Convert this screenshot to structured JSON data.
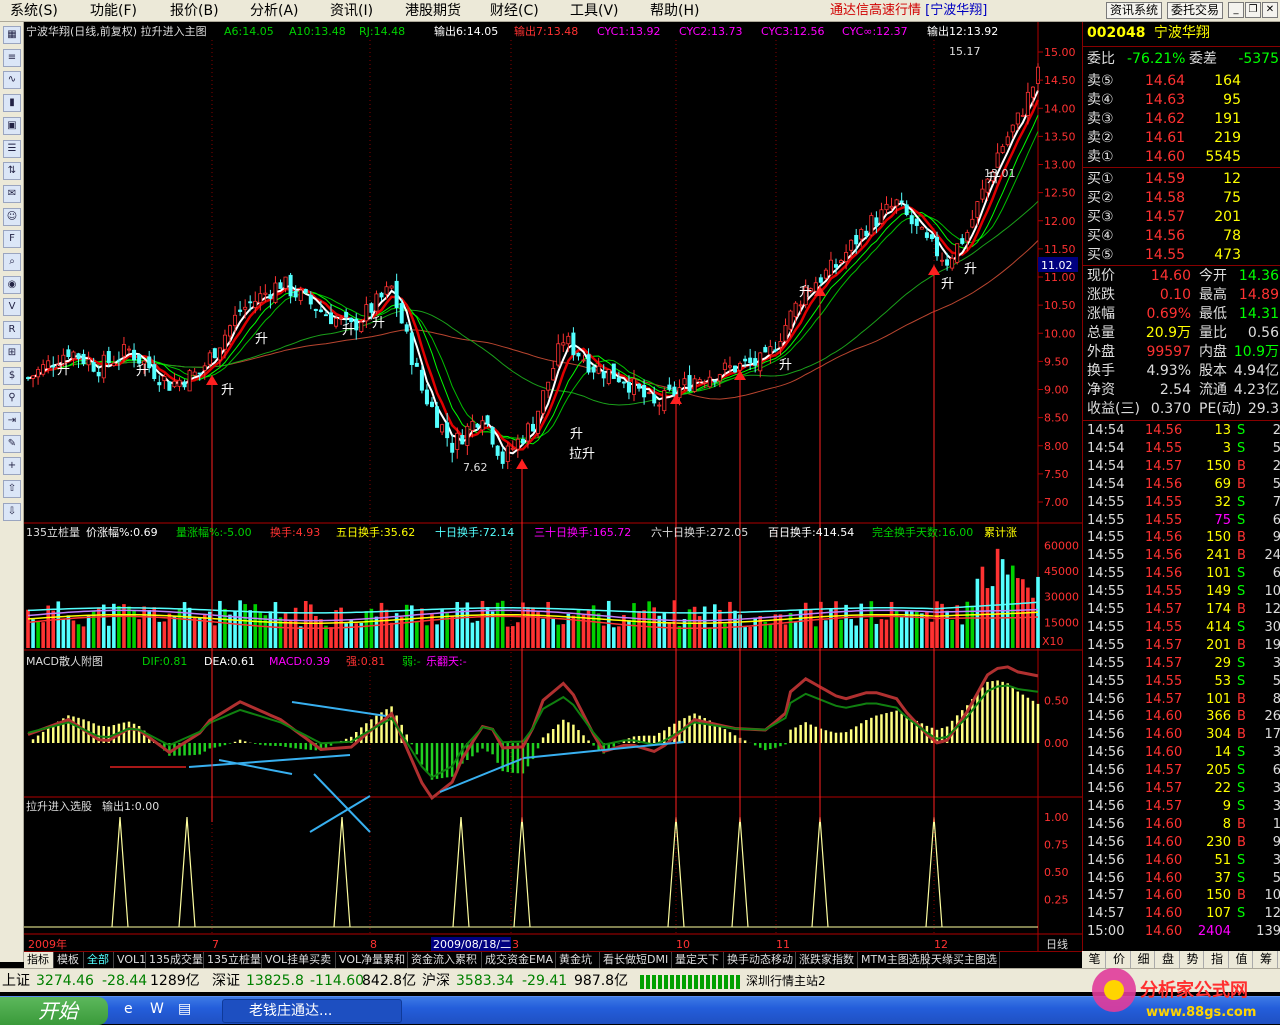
{
  "menu": {
    "items": [
      "系统(S)",
      "功能(F)",
      "报价(B)",
      "分析(A)",
      "资讯(I)",
      "港股期货",
      "财经(C)",
      "工具(V)",
      "帮助(H)"
    ],
    "title": "通达信高速行情",
    "stock_tag": "[宁波华翔]",
    "btn_news": "资讯系统",
    "btn_trade": "委托交易"
  },
  "toolbar_icons": [
    "grid-icon",
    "list-icon",
    "line-chart-icon",
    "kline-icon",
    "window-icon",
    "table-icon",
    "sort-icon",
    "mail-icon",
    "users-icon",
    "f10-icon",
    "search-icon",
    "eye-icon",
    "vol-icon",
    "rsi-icon",
    "calc-icon",
    "dollar-icon",
    "link-icon",
    "exit-icon",
    "pen-icon",
    "plus-icon",
    "up-arrow-icon",
    "down-arrow-icon"
  ],
  "main_header": {
    "name": "宁波华翔(日线,前复权) 拉升进入主图",
    "a6": "A6:14.05",
    "a10": "A10:13.48",
    "rj": "RJ:14.48",
    "out6": "输出6:14.05",
    "out7": "输出7:13.48",
    "cyc1": "CYC1:13.92",
    "cyc2": "CYC2:13.73",
    "cyc3": "CYC3:12.56",
    "cycinf": "CYC∞:12.37",
    "out12": "输出12:13.92"
  },
  "price_axis": [
    "15.00",
    "14.50",
    "14.00",
    "13.50",
    "13.00",
    "12.50",
    "12.00",
    "11.50",
    "11.00",
    "10.50",
    "10.00",
    "9.50",
    "9.00",
    "8.50",
    "8.00",
    "7.50",
    "7.00"
  ],
  "price_marks": {
    "high": "15.17",
    "low": "7.62",
    "mid": "13.01",
    "current": "11.02"
  },
  "signal_label": "升",
  "signal_label2": "拉升",
  "vol_header": {
    "name": "135立桩量",
    "p1": "价涨幅%:0.69",
    "p2": "量涨幅%:-5.00",
    "p3": "换手:4.93",
    "p4": "五日换手:35.62",
    "p5": "十日换手:72.14",
    "p6": "三十日换手:165.72",
    "p7": "六十日换手:272.05",
    "p8": "百日换手:414.54",
    "p9": "完全换手天数:16.00",
    "p10": "累计涨"
  },
  "vol_axis": [
    "60000",
    "45000",
    "30000",
    "15000"
  ],
  "vol_unit": "X10",
  "macd_header": {
    "name": "MACD散人附图",
    "dif": "DIF:0.81",
    "dea": "DEA:0.61",
    "macd": "MACD:0.39",
    "strong": "强:0.81",
    "weak": "弱:-",
    "extra": "乐翻天:-"
  },
  "macd_axis": [
    "0.50",
    "0.00"
  ],
  "sel_header": {
    "name": "拉升进入选股",
    "out": "输出1:0.00"
  },
  "sel_axis": [
    "1.00",
    "0.75",
    "0.50",
    "0.25"
  ],
  "x_axis": {
    "year": "2009年",
    "m7": "7",
    "m8": "8",
    "cursor": "2009/08/18/二",
    "m9": "3",
    "m10": "10",
    "m11": "11",
    "m12": "12",
    "period": "日线"
  },
  "tabs": [
    "指标",
    "模板",
    "全部",
    "VOL1",
    "135成交量",
    "135立桩量",
    "VOL挂单买卖",
    "VOL净量累和",
    "资金流入累积",
    "成交资金EMA",
    "黄金坑",
    "看长做短DMI",
    "量定天下",
    "换手动态移动",
    "涨跌家指数",
    "MTM主图选股",
    "天缘买主图选"
  ],
  "right_panel": {
    "code": "002048",
    "name": "宁波华翔",
    "weibi_label": "委比",
    "weibi": "-76.21%",
    "weicha_label": "委差",
    "weicha": "-5375",
    "asks": [
      {
        "label": "卖⑤",
        "price": "14.64",
        "vol": "164"
      },
      {
        "label": "卖④",
        "price": "14.63",
        "vol": "95"
      },
      {
        "label": "卖③",
        "price": "14.62",
        "vol": "191"
      },
      {
        "label": "卖②",
        "price": "14.61",
        "vol": "219"
      },
      {
        "label": "卖①",
        "price": "14.60",
        "vol": "5545"
      }
    ],
    "bids": [
      {
        "label": "买①",
        "price": "14.59",
        "vol": "12"
      },
      {
        "label": "买②",
        "price": "14.58",
        "vol": "75"
      },
      {
        "label": "买③",
        "price": "14.57",
        "vol": "201"
      },
      {
        "label": "买④",
        "price": "14.56",
        "vol": "78"
      },
      {
        "label": "买⑤",
        "price": "14.55",
        "vol": "473"
      }
    ],
    "quote": [
      {
        "l1": "现价",
        "v1": "14.60",
        "l2": "今开",
        "v2": "14.36"
      },
      {
        "l1": "涨跌",
        "v1": "0.10",
        "l2": "最高",
        "v2": "14.89"
      },
      {
        "l1": "涨幅",
        "v1": "0.69%",
        "l2": "最低",
        "v2": "14.31"
      },
      {
        "l1": "总量",
        "v1": "20.9万",
        "l2": "量比",
        "v2": "0.56"
      },
      {
        "l1": "外盘",
        "v1": "99597",
        "l2": "内盘",
        "v2": "10.9万"
      },
      {
        "l1": "换手",
        "v1": "4.93%",
        "l2": "股本",
        "v2": "4.94亿"
      },
      {
        "l1": "净资",
        "v1": "2.54",
        "l2": "流通",
        "v2": "4.23亿"
      },
      {
        "l1": "收益(三)",
        "v1": "0.370",
        "l2": "PE(动)",
        "v2": "29.3"
      }
    ],
    "ticks": [
      [
        "14:54",
        "14.56",
        "13",
        "S",
        "2"
      ],
      [
        "14:54",
        "14.55",
        "3",
        "S",
        "5"
      ],
      [
        "14:54",
        "14.57",
        "150",
        "B",
        "2"
      ],
      [
        "14:54",
        "14.56",
        "69",
        "B",
        "5"
      ],
      [
        "14:55",
        "14.55",
        "32",
        "S",
        "7"
      ],
      [
        "14:55",
        "14.55",
        "75",
        "S",
        "6"
      ],
      [
        "14:55",
        "14.56",
        "150",
        "B",
        "9"
      ],
      [
        "14:55",
        "14.56",
        "241",
        "B",
        "24"
      ],
      [
        "14:55",
        "14.56",
        "101",
        "S",
        "6"
      ],
      [
        "14:55",
        "14.55",
        "149",
        "S",
        "10"
      ],
      [
        "14:55",
        "14.57",
        "174",
        "B",
        "12"
      ],
      [
        "14:55",
        "14.55",
        "414",
        "S",
        "30"
      ],
      [
        "14:55",
        "14.57",
        "201",
        "B",
        "19"
      ],
      [
        "14:55",
        "14.57",
        "29",
        "S",
        "3"
      ],
      [
        "14:55",
        "14.55",
        "53",
        "S",
        "5"
      ],
      [
        "14:56",
        "14.57",
        "101",
        "B",
        "8"
      ],
      [
        "14:56",
        "14.60",
        "366",
        "B",
        "26"
      ],
      [
        "14:56",
        "14.60",
        "304",
        "B",
        "17"
      ],
      [
        "14:56",
        "14.60",
        "14",
        "S",
        "3"
      ],
      [
        "14:56",
        "14.57",
        "205",
        "S",
        "6"
      ],
      [
        "14:56",
        "14.57",
        "22",
        "S",
        "3"
      ],
      [
        "14:56",
        "14.57",
        "9",
        "S",
        "3"
      ],
      [
        "14:56",
        "14.60",
        "8",
        "B",
        "1"
      ],
      [
        "14:56",
        "14.60",
        "230",
        "B",
        "9"
      ],
      [
        "14:56",
        "14.60",
        "51",
        "S",
        "3"
      ],
      [
        "14:56",
        "14.60",
        "37",
        "S",
        "5"
      ],
      [
        "14:57",
        "14.60",
        "150",
        "B",
        "10"
      ],
      [
        "14:57",
        "14.60",
        "107",
        "S",
        "12"
      ],
      [
        "15:00",
        "14.60",
        "2404",
        "",
        "139"
      ]
    ],
    "tabs": [
      "笔",
      "价",
      "细",
      "盘",
      "势",
      "指",
      "值",
      "筹"
    ]
  },
  "status": {
    "sh_label": "上证",
    "sh_val": "3274.46",
    "sh_chg": "-28.44",
    "sh_amt": "1289亿",
    "sz_label": "深证",
    "sz_val": "13825.8",
    "sz_chg": "-114.60",
    "sz_amt": "842.8亿",
    "hs_label": "沪深",
    "hs_val": "3583.34",
    "hs_chg": "-29.41",
    "hs_amt": "987.8亿",
    "server": "深圳行情主站2"
  },
  "taskbar": {
    "start": "开始",
    "task": "老钱庄通达..."
  },
  "watermark": {
    "line1": "分析家公式网",
    "line2": "www.88gs.com"
  },
  "colors": {
    "up": "#ff3232",
    "down": "#54ffff",
    "green": "#00d000",
    "yellow": "#ffff00",
    "magenta": "#ff00ff",
    "white": "#ffffff",
    "axis": "#b00000"
  }
}
